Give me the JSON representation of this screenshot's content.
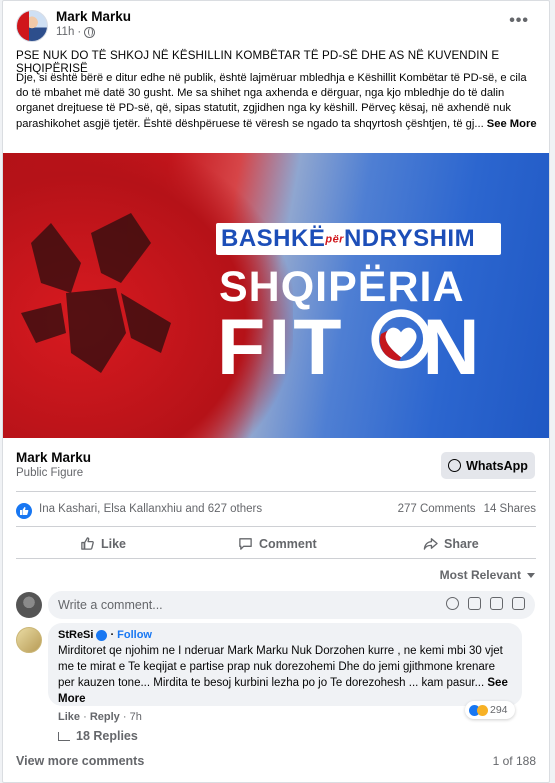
{
  "post": {
    "author": "Mark Marku",
    "time": "11h",
    "title": "PSE NUK DO TË SHKOJ NË KËSHILLIN KOMBËTAR TË PD-SË DHE AS NË KUVENDIN E SHQIPËRISË",
    "body": "Dje, si është bërë e ditur edhe në publik, është lajmëruar mbledhja e Këshillit Kombëtar të PD-së, e cila do të mbahet më datë 30 gusht. Me sa shihet nga axhenda e dërguar, nga kjo mbledhje do të dalin organet drejtuese të PD-së, që, sipas statutit, zgjidhen nga ky këshill. Përveç kësaj, në axhendë nuk parashikohet asgjë tjetër. Është dëshpëruese të vëresh se ngado ta shqyrtosh çështjen, të gj...",
    "see_more": "See More"
  },
  "hero": {
    "badge_left": "BASHKË",
    "badge_per": "për",
    "badge_right": "NDRYSHIM",
    "line1": "SHQIPËRIA",
    "line2_a": "FIT",
    "line2_b": "N"
  },
  "page": {
    "name": "Mark Marku",
    "category": "Public Figure",
    "whatsapp_label": "WhatsApp"
  },
  "reactions": {
    "names": "Ina Kashari, Elsa Kallanxhiu and 627 others",
    "comments": "277 Comments",
    "shares": "14 Shares"
  },
  "actions": {
    "like": "Like",
    "comment": "Comment",
    "share": "Share"
  },
  "comments": {
    "sort_label": "Most Relevant",
    "input_placeholder": "Write a comment...",
    "items": [
      {
        "name": "StReSi",
        "follow": "Follow",
        "text": "Mirditoret qe njohim ne I nderuar Mark Marku Nuk Dorzohen kurre , ne kemi mbi 30 vjet me te mirat e Te keqijat e partise prap nuk dorezohemi Dhe do jemi gjithmone krenare per kauzen tone... Mirdita te besoj kurbini lezha po jo Te dorezohesh ... kam pasur...",
        "see_more": "See More",
        "like": "Like",
        "reply": "Reply",
        "time": "7h",
        "reaction_count": "294",
        "replies": "18 Replies"
      }
    ],
    "view_more": "View more comments",
    "pager": "1 of 188"
  },
  "colors": {
    "accent": "#1877f2",
    "muted": "#65676b",
    "flag_red": "#d0161b",
    "badge_blue": "#1c4eb8"
  }
}
